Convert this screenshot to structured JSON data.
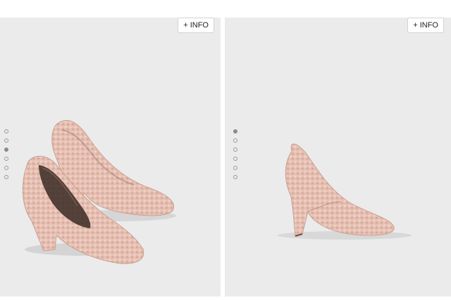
{
  "panels": [
    {
      "info_label": "+ INFO",
      "image": "pink-shearling-pumps-pair",
      "dots": [
        false,
        false,
        true,
        false,
        false,
        false
      ]
    },
    {
      "info_label": "+ INFO",
      "image": "pink-shearling-pump-side-view",
      "dots": [
        true,
        false,
        false,
        false,
        false,
        false
      ]
    }
  ],
  "colors": {
    "background": "#ebebeb",
    "shoe_fur": "#e3bcae",
    "shoe_shadow": "#c99c8e",
    "dot_active": "#8a8a8a"
  }
}
